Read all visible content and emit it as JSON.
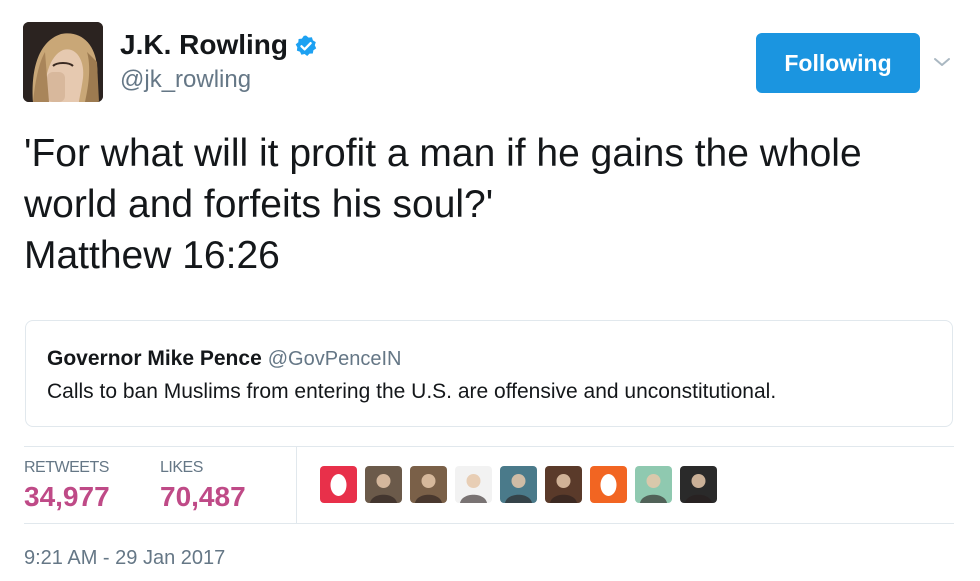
{
  "author": {
    "display_name": "J.K. Rowling",
    "handle": "@jk_rowling",
    "verified": true,
    "avatar_icon": "profile-photo"
  },
  "follow_button": {
    "label": "Following",
    "color": "#1b95e0"
  },
  "tweet": {
    "lines": [
      "'For what will it profit a man if he gains the whole",
      "world and forfeits his soul?'",
      "Matthew 16:26"
    ]
  },
  "quoted_tweet": {
    "author_name": "Governor Mike Pence",
    "author_handle": "@GovPenceIN",
    "text": "Calls to ban Muslims from entering the U.S. are offensive and unconstitutional."
  },
  "stats": {
    "retweets_label": "RETWEETS",
    "retweets_value": "34,977",
    "likes_label": "LIKES",
    "likes_value": "70,487",
    "value_color": "#bf4a87"
  },
  "facepile": [
    {
      "name": "face-1",
      "bg": "#e8304a",
      "kind": "egg"
    },
    {
      "name": "face-2",
      "bg": "#6b5a4a",
      "kind": "photo"
    },
    {
      "name": "face-3",
      "bg": "#7a6048",
      "kind": "photo"
    },
    {
      "name": "face-4",
      "bg": "#f2f2f2",
      "kind": "photo"
    },
    {
      "name": "face-5",
      "bg": "#4a7a8a",
      "kind": "photo"
    },
    {
      "name": "face-6",
      "bg": "#5a3a2a",
      "kind": "photo"
    },
    {
      "name": "face-7",
      "bg": "#f26522",
      "kind": "egg"
    },
    {
      "name": "face-8",
      "bg": "#8fc9b0",
      "kind": "photo"
    },
    {
      "name": "face-9",
      "bg": "#2a2a2a",
      "kind": "photo"
    }
  ],
  "timestamp": "9:21 AM - 29 Jan 2017"
}
